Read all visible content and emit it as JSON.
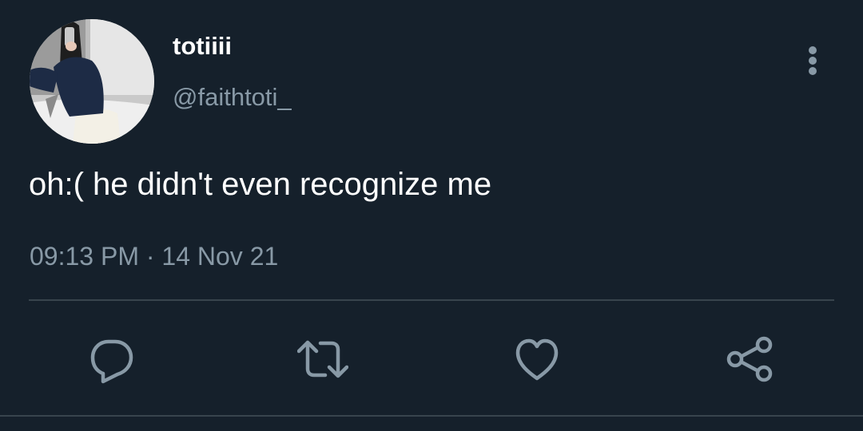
{
  "user": {
    "display_name": "totiiii",
    "handle": "@faithtoti_"
  },
  "tweet": {
    "text": "oh:( he didn't even recognize me",
    "time": "09:13 PM",
    "separator": " · ",
    "date": "14 Nov 21"
  },
  "actions": [
    {
      "icon": "reply-icon"
    },
    {
      "icon": "retweet-icon"
    },
    {
      "icon": "like-icon"
    },
    {
      "icon": "share-icon"
    }
  ],
  "colors": {
    "background": "#15202b",
    "primary_text": "#ffffff",
    "secondary_text": "#8899a6",
    "icon": "#8899a6",
    "divider": "#38444d"
  }
}
